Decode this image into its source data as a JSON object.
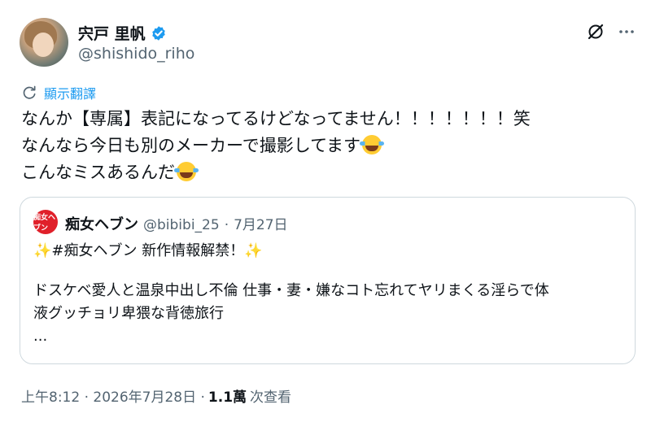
{
  "author": {
    "display_name": "宍戸 里帆",
    "handle": "@shishido_riho"
  },
  "icons": {
    "verified": "verified-badge-icon",
    "grok": "grok-icon",
    "more": "more-options-icon",
    "translate": "translate-icon",
    "emoji": "face-with-tears-of-joy-emoji"
  },
  "colors": {
    "accent": "#1d9bf0",
    "secondary_text": "#536471",
    "border": "#cfd9de"
  },
  "translate_label": "顯示翻譯",
  "tweet": {
    "line1": "なんか【専属】表記になってるけどなってません！！！！！！！笑",
    "line2": "なんなら今日も別のメーカーで撮影してます",
    "line3": "こんなミスあるんだ"
  },
  "quote": {
    "avatar_text": "痴女ヘブン",
    "name": "痴女ヘブン",
    "handle": "@bibibi_25",
    "separator": "·",
    "date": "7月27日",
    "headline": "#痴女ヘブン 新作情報解禁！",
    "body_line1": "ドスケベ愛人と温泉中出し不倫 仕事・妻・嫌なコト忘れてヤリまくる淫らで体",
    "body_line2": "液グッチョリ卑猥な背徳旅行",
    "ellipsis": "..."
  },
  "meta": {
    "timestamp": "上午8:12 · 2026年7月28日 ·",
    "views_count": "1.1萬",
    "views_label": "次查看"
  }
}
